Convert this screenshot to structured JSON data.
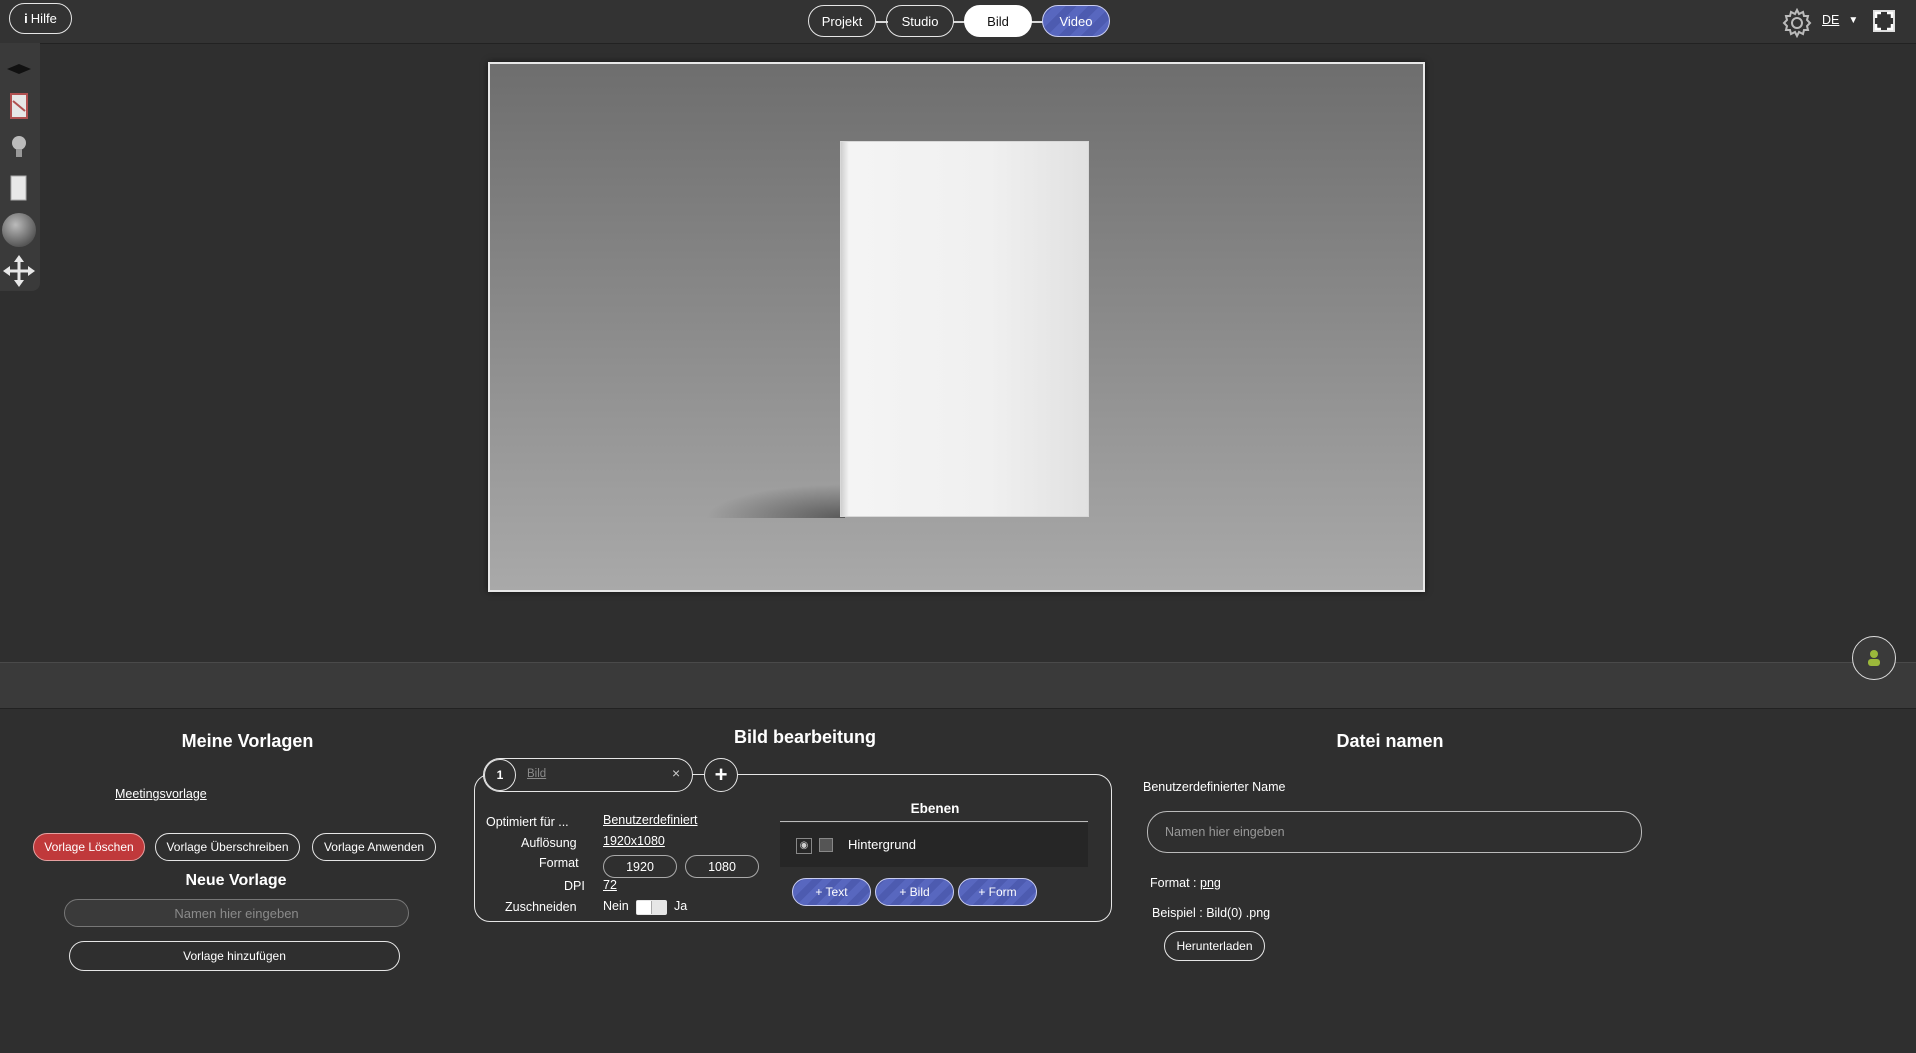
{
  "topbar": {
    "help_label": "Hilfe",
    "tabs": [
      {
        "label": "Projekt",
        "active": false
      },
      {
        "label": "Studio",
        "active": false
      },
      {
        "label": "Bild",
        "active": true
      },
      {
        "label": "Video",
        "active": false
      }
    ],
    "language": "DE"
  },
  "tools": [
    "shelf-icon",
    "book-stack-icon",
    "lightbulb-icon",
    "panel-icon",
    "sphere-icon",
    "move-arrows-icon"
  ],
  "templates": {
    "title": "Meine Vorlagen",
    "items": [
      "Meetingsvorlage"
    ],
    "delete_label": "Vorlage Löschen",
    "overwrite_label": "Vorlage Überschreiben",
    "apply_label": "Vorlage Anwenden",
    "new_title": "Neue Vorlage",
    "name_placeholder": "Namen hier eingeben",
    "add_label": "Vorlage hinzufügen"
  },
  "editing": {
    "title": "Bild bearbeitung",
    "tab_number": "1",
    "tab_name": "Bild",
    "optimized_label": "Optimiert für ...",
    "optimized_value": "Benutzerdefiniert",
    "resolution_label": "Auflösung",
    "resolution_value": "1920x1080",
    "format_label": "Format",
    "width": "1920",
    "height": "1080",
    "dpi_label": "DPI",
    "dpi_value": "72",
    "crop_label": "Zuschneiden",
    "crop_no": "Nein",
    "crop_yes": "Ja",
    "layers_title": "Ebenen",
    "layers": [
      "Hintergrund"
    ],
    "add_text": "+ Text",
    "add_image": "+ Bild",
    "add_shape": "+ Form"
  },
  "filenames": {
    "title": "Datei namen",
    "custom_name_label": "Benutzerdefinierter Name",
    "name_placeholder": "Namen hier eingeben",
    "format_label": "Format :",
    "format_value": "png",
    "example_label": "Beispiel : Bild(0) .png",
    "download_label": "Herunterladen"
  },
  "colors": {
    "accent_blue": "#5361b8",
    "danger_red": "#c0393b",
    "background": "#2f2f2f"
  }
}
